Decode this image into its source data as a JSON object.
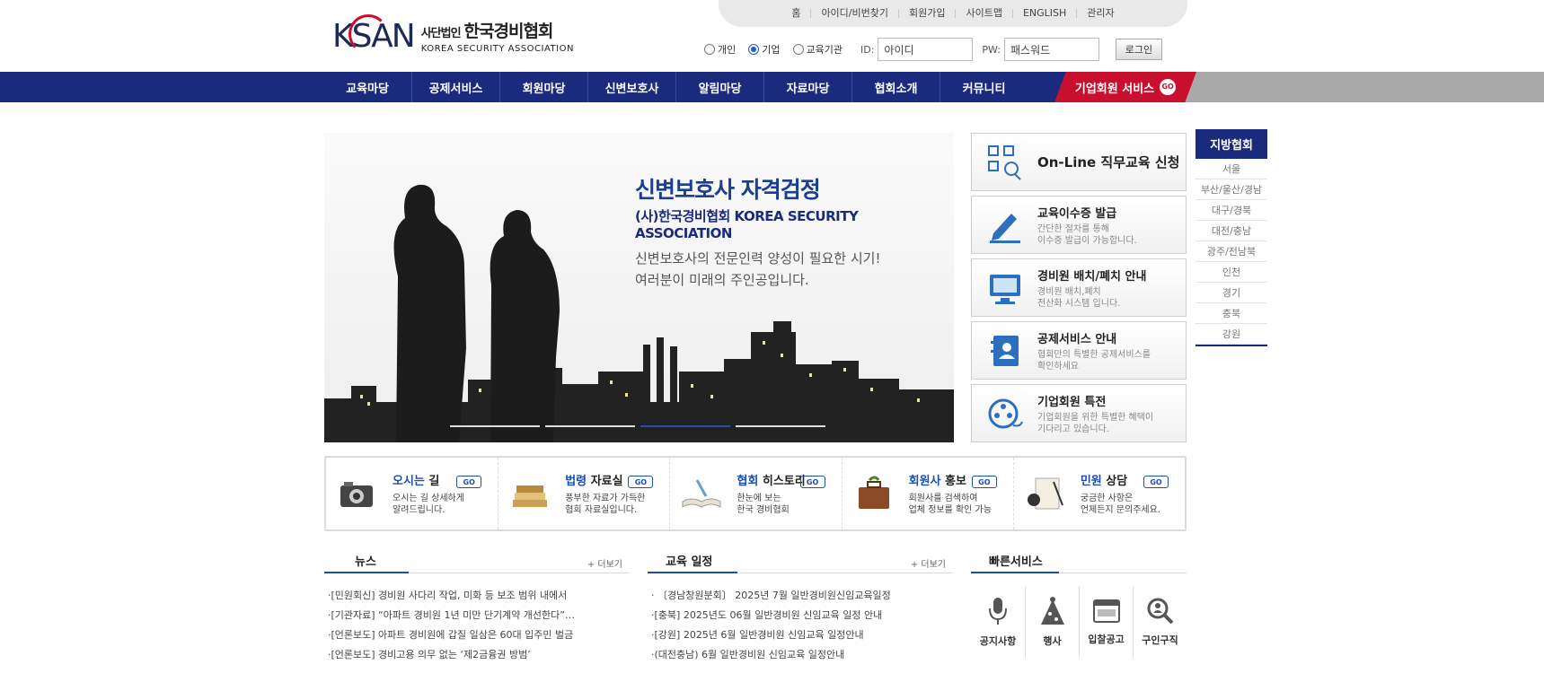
{
  "logo": {
    "mark": "KSAN",
    "ko_prefix": "사단법인",
    "ko_name": "한국경비협회",
    "en": "KOREA SECURITY ASSOCIATION"
  },
  "util": [
    "홈",
    "아이디/비번찾기",
    "회원가입",
    "사이트맵",
    "ENGLISH",
    "관리자"
  ],
  "login": {
    "types": [
      {
        "label": "개인",
        "checked": false
      },
      {
        "label": "기업",
        "checked": true
      },
      {
        "label": "교육기관",
        "checked": false
      }
    ],
    "id_label": "ID:",
    "id_placeholder": "아이디",
    "pw_label": "PW:",
    "pw_placeholder": "패스워드",
    "button": "로그인"
  },
  "nav": [
    "교육마당",
    "공제서비스",
    "회원마당",
    "신변보호사",
    "알림마당",
    "자료마당",
    "협회소개",
    "커뮤니티"
  ],
  "nav_corp": {
    "label": "기업회원 서비스",
    "badge": "GO"
  },
  "hero": {
    "title": "신변보호사 자격검정",
    "subtitle": "(사)한국경비협회 KOREA SECURITY ASSOCIATION",
    "desc1": "신변보호사의 전문인력 양성이 필요한 시기!",
    "desc2": "여러분이 미래의 주인공입니다."
  },
  "cards": [
    {
      "title": "On-Line 직무교육 신청",
      "desc1": "",
      "desc2": "",
      "icon": "qr-icon"
    },
    {
      "title": "교육이수증 발급",
      "desc1": "간단한 절차를 통해",
      "desc2": "이수증 발급이 가능합니다.",
      "icon": "pencil-icon"
    },
    {
      "title": "경비원 배치/폐치 안내",
      "desc1": "경비원 배치,폐치",
      "desc2": "전산화 시스템 입니다.",
      "icon": "monitor-icon"
    },
    {
      "title": "공제서비스 안내",
      "desc1": "협회만의 특별한 공제서비스를",
      "desc2": "확인하세요",
      "icon": "contact-book-icon"
    },
    {
      "title": "기업회원 특전",
      "desc1": "기업회원을 위한 특별한 혜택이",
      "desc2": "기다리고 있습니다.",
      "icon": "film-reel-icon"
    }
  ],
  "local": {
    "title": "지방협회",
    "items": [
      "서울",
      "부산/울산/경남",
      "대구/경북",
      "대전/충남",
      "광주/전남북",
      "인천",
      "경기",
      "충북",
      "강원"
    ]
  },
  "strip": [
    {
      "title_b": "오시는",
      "title": " 길",
      "d1": "오시는 길 상세하게",
      "d2": "알려드립니다.",
      "go": "GO"
    },
    {
      "title_b": "법령",
      "title": " 자료실",
      "d1": "풍부한 자료가 가득한",
      "d2": "협회 자료실입니다.",
      "go": "GO"
    },
    {
      "title_b": "협회",
      "title": " 히스토리",
      "d1": "한눈에 보는",
      "d2": "한국 경비협회",
      "go": "GO"
    },
    {
      "title_b": "회원사",
      "title": " 홍보",
      "d1": "회원사를 검색하여",
      "d2": "업체 정보를 확인 가능",
      "go": "GO"
    },
    {
      "title_b": "민원",
      "title": " 상담",
      "d1": "궁금한 사항은",
      "d2": "언제든지 문의주세요.",
      "go": "GO"
    }
  ],
  "news": {
    "title": "뉴스",
    "more": "+ 더보기",
    "items": [
      "·[민원회신] 경비원 사다리 작업, 미화 등 보조 범위 내에서",
      "·[기관자료] “아파트 경비원 1년 미만 단기계약 개선한다”…",
      "·[언론보도] 아파트 경비원에 갑질 일삼은 60대 입주민 벌금",
      "·[언론보도] 경비고용 의무 없는 ‘제2금융권 방범’"
    ]
  },
  "edu": {
    "title": "교육 일정",
    "more": "+ 더보기",
    "items": [
      "· 〔경남창원분회〕 2025년 7월 일반경비원신임교육일정",
      "·[충북] 2025년도 06월 일반경비원 신임교육 일정 안내",
      "·[강원] 2025년 6월 일반경비원 신임교육 일정안내",
      "·(대전충남) 6월 일반경비원 신임교육 일정안내"
    ]
  },
  "quick": {
    "title": "빠른서비스",
    "items": [
      {
        "label": "공지사항",
        "icon": "microphone-icon"
      },
      {
        "label": "행사",
        "icon": "party-icon"
      },
      {
        "label": "입찰공고",
        "icon": "browser-window-icon"
      },
      {
        "label": "구인구직",
        "icon": "magnifier-person-icon"
      }
    ]
  },
  "colors": {
    "navy": "#1a2a7c",
    "red": "#c8102e",
    "blue": "#1a4fb0"
  }
}
